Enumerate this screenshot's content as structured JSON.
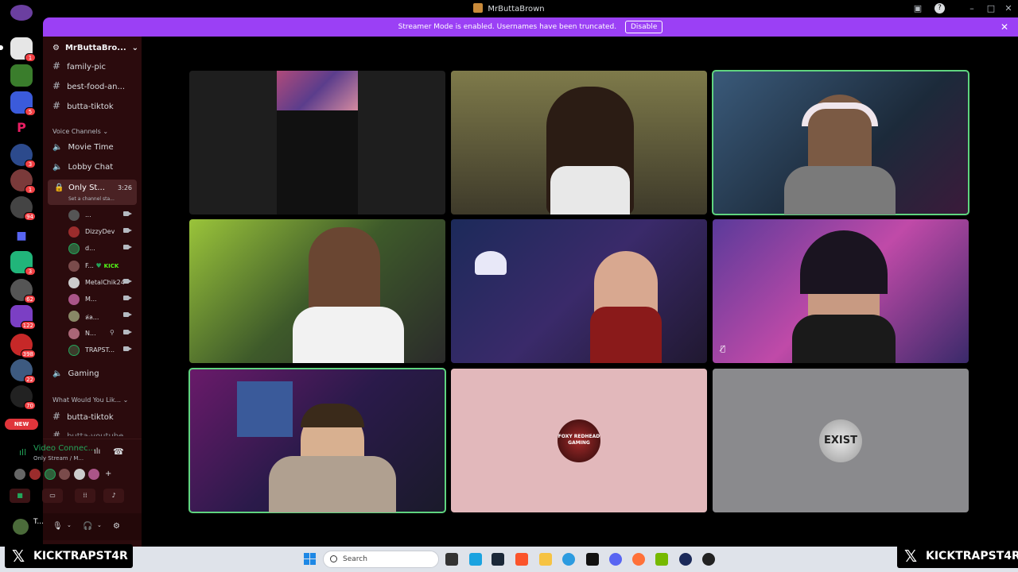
{
  "window": {
    "title": "MrButtaBrown"
  },
  "banner": {
    "message": "Streamer Mode is enabled. Usernames have been truncated.",
    "disable_label": "Disable"
  },
  "sidebar": {
    "server_name": "MrButtaBro...",
    "text_channels_top": [
      "family-pic",
      "best-food-an...",
      "butta-tiktok"
    ],
    "voice_category": "Voice Channels",
    "voice_channels": [
      "Movie Time",
      "Lobby Chat"
    ],
    "active_channel": {
      "name": "Only St...",
      "time": "3:26",
      "status": "Set a channel sta..."
    },
    "voice_users": [
      {
        "name": "...",
        "camera": true
      },
      {
        "name": "DizzyDev",
        "camera": true
      },
      {
        "name": "d...",
        "camera": true
      },
      {
        "name": "F...",
        "badge": "KICK",
        "camera": false
      },
      {
        "name": "MetalChik24",
        "camera": true
      },
      {
        "name": "M...",
        "camera": true
      },
      {
        "name": "ล่ล...",
        "camera": true
      },
      {
        "name": "N...",
        "camera": true
      },
      {
        "name": "TRAPST...",
        "camera": true
      }
    ],
    "gaming_channel": "Gaming",
    "category_2": "What Would You Lik...",
    "text_channels_bottom": [
      "butta-tiktok",
      "butta-youtube"
    ]
  },
  "rail": {
    "badges": [
      "1",
      "5",
      "3",
      "1",
      "94",
      "3",
      "62",
      "122",
      "398",
      "22",
      "70"
    ],
    "new_label": "NEW"
  },
  "voice_panel": {
    "status": "Video Connec...",
    "channel": "Only Stream / M..."
  },
  "user_panel": {
    "name": "T..."
  },
  "taskbar": {
    "search_placeholder": "Search"
  },
  "watermark": {
    "left": "KICKTRAPST4R",
    "right": "KICKTRAPST4R"
  },
  "tiles": [
    {
      "id": "tile-1",
      "kind": "screen"
    },
    {
      "id": "tile-2",
      "kind": "camera"
    },
    {
      "id": "tile-3",
      "kind": "camera",
      "speaking": true
    },
    {
      "id": "tile-4",
      "kind": "camera"
    },
    {
      "id": "tile-5",
      "kind": "camera"
    },
    {
      "id": "tile-6",
      "kind": "camera",
      "muted": true
    },
    {
      "id": "tile-7",
      "kind": "camera",
      "speaking": true
    },
    {
      "id": "tile-8",
      "kind": "avatar",
      "avatar_text": "FOXY REDHEAD GAMING"
    },
    {
      "id": "tile-9",
      "kind": "avatar",
      "avatar_text": "EXIST"
    }
  ],
  "colors": {
    "banner": "#9b40f5",
    "sidebar": "#2b0b0d",
    "speaking": "#5fd47f",
    "tile8_bg": "#e2b8bb",
    "tile9_bg": "#8a8a8d"
  }
}
